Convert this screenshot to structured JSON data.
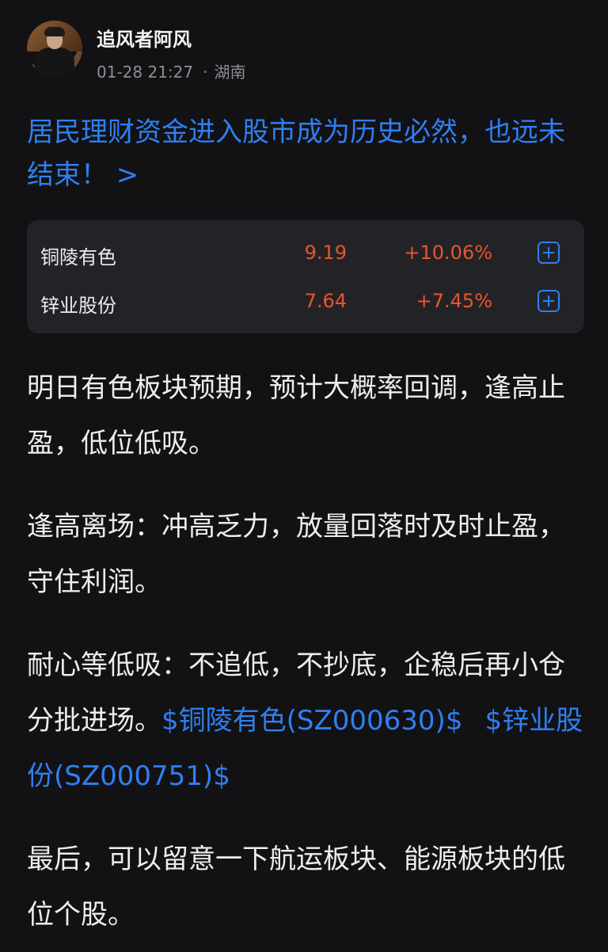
{
  "post": {
    "author": "追风者阿风",
    "date": "01-28 21:27",
    "location": "湖南",
    "title": "居民理财资金进入股市成为历史必然，也远未结束！ >"
  },
  "stocks": [
    {
      "name": "铜陵有色",
      "price": "9.19",
      "change": "+10.06%",
      "add_icon": "plus-square-icon"
    },
    {
      "name": "锌业股份",
      "price": "7.64",
      "change": "+7.45%",
      "add_icon": "plus-square-icon"
    }
  ],
  "paragraphs": {
    "p1": "明日有色板块预期，预计大概率回调，逢高止盈，低位低吸。",
    "p2": "逢高离场：冲高乏力，放量回落时及时止盈，守住利润。",
    "p3_text": "耐心等低吸：不追低，不抄底，企稳后再小仓分批进场。",
    "p3_link1": "$铜陵有色(SZ000630)$",
    "p3_link2": "$锌业股份(SZ000751)$",
    "p4": "最后，可以留意一下航运板块、能源板块的低位个股。"
  },
  "colors": {
    "background": "#121214",
    "link": "#2f7ff2",
    "up": "#e8552f",
    "card": "#232327"
  }
}
